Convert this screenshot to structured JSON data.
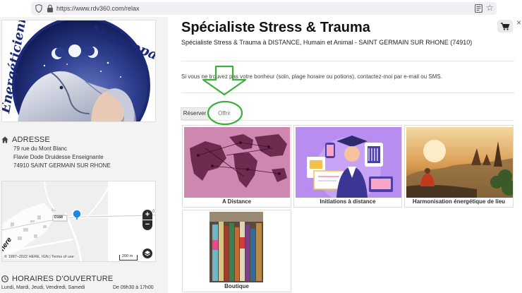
{
  "browser": {
    "url": "https://www.rdv360.com/relax"
  },
  "sidebar": {
    "logo_text": "Énergéticienne Naturopathe",
    "address": {
      "heading": "ADRESSE",
      "line1": "79 rue du Mont Blanc",
      "line2": "Flavie Dode Druidesse Enseignante",
      "line3": "74910 SAINT GERMAIN SUR RHONE"
    },
    "map": {
      "road_label": "D168",
      "copyright": "© 1987–2022 HERE, IGN | Terms of use",
      "scale": "200 m",
      "logo": "here",
      "zoom_in": "+",
      "zoom_out": "−",
      "edge_label": "0"
    },
    "hours": {
      "heading": "HORAIRES D'OUVERTURE",
      "days": "Lundi, Mardi, Jeudi, Vendredi, Samedi",
      "time": "De 09h30 à 17h00"
    }
  },
  "main": {
    "title": "Spécialiste Stress & Trauma",
    "subtitle": "Spécialiste Stress & Trauma à DISTANCE, Humain et Animal - SAINT GERMAIN SUR RHONE (74910)",
    "notice": "Si vous ne trouvez pas votre bonheur (soin, plage horaire ou potions), contactez-moi par e-mail ou SMS.",
    "tabs": [
      {
        "label": "Réserver"
      },
      {
        "label": "Offrir"
      }
    ],
    "cards": [
      {
        "label": "A Distance"
      },
      {
        "label": "Initiations à distance"
      },
      {
        "label": "Harmonisation énergétique de lieu"
      },
      {
        "label": "Boutique"
      }
    ]
  },
  "colors": {
    "annotation_green": "#3daf3d",
    "map_pin": "#1e88e5"
  }
}
